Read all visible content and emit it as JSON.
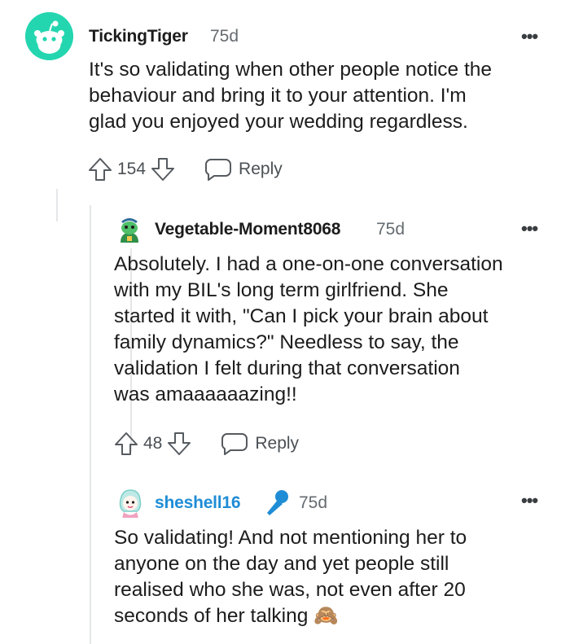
{
  "comments": [
    {
      "username": "TickingTiger",
      "age": "75d",
      "more": "•••",
      "lines": [
        "It's so validating when other people notice the",
        "behaviour and bring it to your attention. I'm",
        "glad you enjoyed your wedding regardless."
      ],
      "score": "154",
      "reply_label": "Reply",
      "avatar_color": "#24d6b0"
    },
    {
      "username": "Vegetable-Moment8068",
      "age": "75d",
      "more": "•••",
      "lines": [
        "Absolutely. I had a one-on-one conversation",
        "with my BIL's long term girlfriend. She",
        "started it with, \"Can I pick your brain about",
        "family dynamics?\" Needless to say, the",
        "validation I felt during that conversation",
        "was amaaaaaazing!!"
      ],
      "score": "48",
      "reply_label": "Reply"
    },
    {
      "username": "sheshell16",
      "username_color": "#1f8dd6",
      "badge_icon": "microphone-icon",
      "age": "75d",
      "more": "•••",
      "lines": [
        "So validating! And not mentioning her to",
        "anyone on the day and yet people still",
        "realised who she was, not even after 20",
        "seconds of her talking"
      ],
      "emoji": "🙈"
    }
  ]
}
